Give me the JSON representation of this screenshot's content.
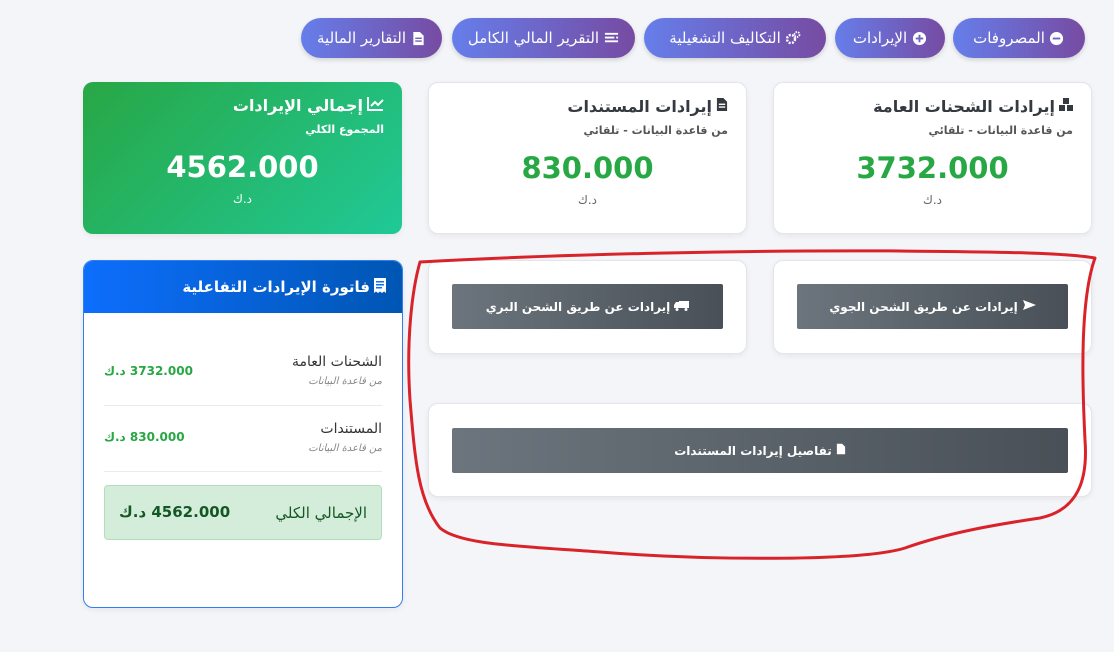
{
  "nav": {
    "expenses": "المصروفات",
    "revenues": "الإيرادات",
    "operating_costs": "التكاليف التشغيلية",
    "full_report": "التقرير المالي الكامل",
    "financial_reports": "التقارير المالية"
  },
  "summary": {
    "shipments": {
      "title": "إيرادات الشحنات العامة",
      "sub": "من قاعدة البيانات - تلقائي",
      "value": "3732.000",
      "unit": "د.ك"
    },
    "documents": {
      "title": "إيرادات المستندات",
      "sub": "من قاعدة البيانات - تلقائي",
      "value": "830.000",
      "unit": "د.ك"
    },
    "total": {
      "title": "إجمالي الإيرادات",
      "sub": "المجموع الكلي",
      "value": "4562.000",
      "unit": "د.ك"
    }
  },
  "actions": {
    "air": "إيرادات عن طريق الشحن الجوي",
    "land": "إيرادات عن طريق الشحن البري",
    "docs_details": "تفاصيل إيرادات المستندات"
  },
  "invoice": {
    "title": "فاتورة الإيرادات التفاعلية",
    "rows": [
      {
        "label": "الشحنات العامة",
        "source": "من قاعدة البيانات",
        "amount": "3732.000 د.ك"
      },
      {
        "label": "المستندات",
        "source": "من قاعدة البيانات",
        "amount": "830.000 د.ك"
      }
    ],
    "total_label": "الإجمالي الكلي",
    "total_value": "4562.000 د.ك"
  },
  "colors": {
    "accent_gradient": [
      "#667eea",
      "#764ba2"
    ],
    "success": "#28a745",
    "primary": "#0d6efd",
    "annotation": "#d9232a"
  },
  "icons": {
    "expenses": "minus-circle-icon",
    "revenues": "plus-circle-icon",
    "operating_costs": "gears-icon",
    "full_report": "list-icon",
    "financial_reports": "file-icon",
    "shipments": "boxes-icon",
    "documents": "file-icon",
    "total": "chart-line-icon",
    "air": "plane-icon",
    "land": "truck-icon",
    "docs_details": "file-icon",
    "invoice": "receipt-icon"
  }
}
